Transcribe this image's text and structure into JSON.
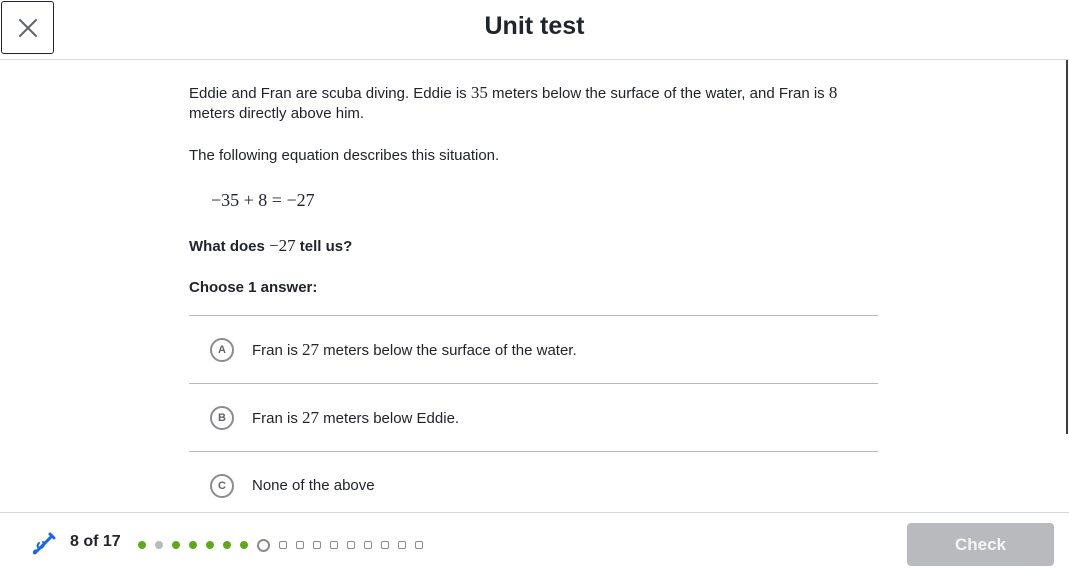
{
  "header": {
    "title": "Unit test",
    "close_icon": "close-icon"
  },
  "question": {
    "p1_a": "Eddie and Fran are scuba diving. Eddie is ",
    "p1_num1": "35",
    "p1_b": " meters below the surface of the water, and Fran is ",
    "p1_num2": "8",
    "p1_c": " meters directly above him.",
    "p2": "The following equation describes this situation.",
    "equation": "−35 + 8 = −27",
    "q_a": "What does ",
    "q_num": "−27",
    "q_b": " tell us?",
    "choose_label": "Choose 1 answer:"
  },
  "choices": [
    {
      "letter": "A",
      "text_a": "Fran is ",
      "num": "27",
      "text_b": " meters below the surface of the water."
    },
    {
      "letter": "B",
      "text_a": "Fran is ",
      "num": "27",
      "text_b": " meters below Eddie."
    },
    {
      "letter": "C",
      "text_a": "None of the above",
      "num": "",
      "text_b": ""
    }
  ],
  "footer": {
    "progress_text": "8 of 17",
    "progress": [
      "done",
      "skipped",
      "done",
      "done",
      "done",
      "done",
      "done",
      "current",
      "todo",
      "todo",
      "todo",
      "todo",
      "todo",
      "todo",
      "todo",
      "todo",
      "todo"
    ],
    "check_label": "Check",
    "colors": {
      "done": "#5fa81a",
      "skipped": "#b8babd",
      "check_disabled": "#b8babd",
      "pencil": "#1865f2"
    }
  }
}
